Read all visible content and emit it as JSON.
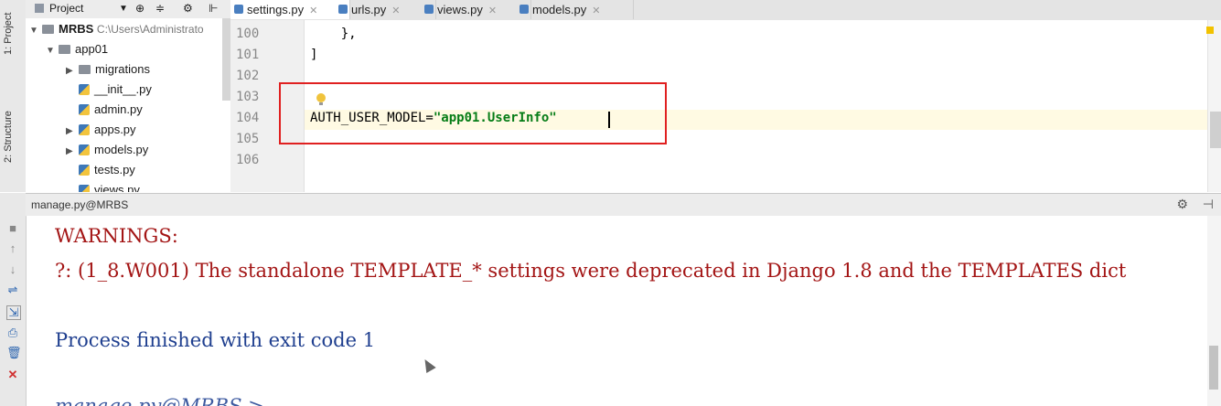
{
  "left_tools": [
    "1: Project",
    "2: Structure"
  ],
  "project_toolbar": {
    "label": "Project",
    "icons": [
      "chevron-down-icon",
      "settings-icon",
      "collapse-icon",
      "gear-icon",
      "hide-icon"
    ]
  },
  "tabs": [
    {
      "label": "settings.py",
      "active": true
    },
    {
      "label": "urls.py",
      "active": false
    },
    {
      "label": "views.py",
      "active": false
    },
    {
      "label": "models.py",
      "active": false
    }
  ],
  "tree": {
    "root": {
      "name": "MRBS",
      "path": "C:\\Users\\Administrato"
    },
    "items": [
      {
        "name": "app01",
        "type": "folder",
        "expanded": true
      },
      {
        "name": "migrations",
        "type": "folder",
        "expanded": false
      },
      {
        "name": "__init__.py",
        "type": "file"
      },
      {
        "name": "admin.py",
        "type": "file"
      },
      {
        "name": "apps.py",
        "type": "file",
        "expandable": true
      },
      {
        "name": "models.py",
        "type": "file",
        "expandable": true
      },
      {
        "name": "tests.py",
        "type": "file"
      },
      {
        "name": "views.py",
        "type": "file"
      }
    ]
  },
  "editor": {
    "line_numbers": [
      "100",
      "101",
      "102",
      "103",
      "104",
      "105",
      "106"
    ],
    "lines": {
      "l100": "    },",
      "l101": "]",
      "l104_key": "AUTH_USER_MODEL=",
      "l104_value": "\"app01.UserInfo\""
    }
  },
  "run": {
    "title": "manage.py@MRBS",
    "console": [
      {
        "text": "WARNINGS:",
        "kind": "warn"
      },
      {
        "text": "?: (1_8.W001) The standalone TEMPLATE_* settings were deprecated in Django 1.8 and the TEMPLATES dict",
        "kind": "warn"
      },
      {
        "text": "Process finished with exit code 1",
        "kind": "info"
      },
      {
        "text": "manage.py@MRBS >",
        "kind": "prompt"
      }
    ]
  },
  "colors": {
    "highlight_box": "#e02020",
    "string": "#067d17",
    "warning_text": "#a31515",
    "info_text": "#1f3f8f"
  }
}
